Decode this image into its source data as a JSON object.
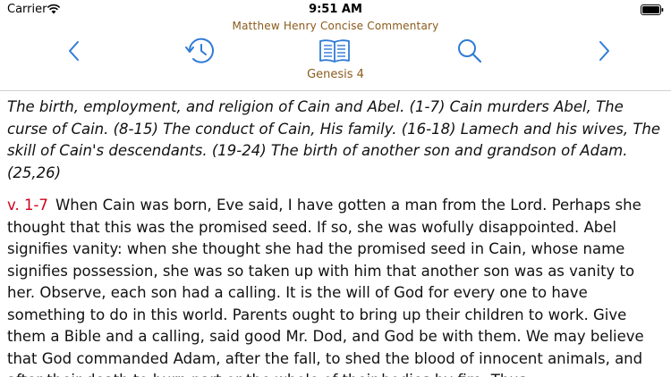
{
  "status_bar": {
    "carrier": "Carrier",
    "time": "9:51 AM"
  },
  "header": {
    "title": "Matthew Henry Concise Commentary",
    "book_label": "Genesis 4"
  },
  "toolbar": {
    "icons": [
      "chevron-left-icon",
      "history-clock-icon",
      "open-book-icon",
      "search-icon",
      "chevron-right-icon"
    ],
    "accent_color": "#2f7bd6",
    "title_color": "#8a5a1a"
  },
  "content": {
    "summary": "The birth, employment, and religion of Cain and Abel. (1-7) Cain murders Abel, The curse of Cain. (8-15) The conduct of Cain, His family. (16-18) Lamech and his wives, The skill of Cain's descendants. (19-24) The birth of another son and grandson of Adam. (25,26)",
    "verse_ref": "v. 1-7",
    "verse_ref_color": "#d0021b",
    "commentary": "When Cain was born, Eve said, I have gotten a man from the Lord. Perhaps she thought that this was the promised seed. If so, she was wofully disappointed. Abel signifies vanity: when she thought she had the promised seed in Cain, whose name signifies possession, she was so taken up with him that another son was as vanity to her. Observe, each son had a calling. It is the will of God for every one to have something to do in this world. Parents ought to bring up their children to work. Give them a Bible and a calling, said good Mr. Dod, and God be with them. We may believe that God commanded Adam, after the fall, to shed the blood of innocent animals, and after their death to burn part or the whole of their bodies by fire. Thus"
  }
}
